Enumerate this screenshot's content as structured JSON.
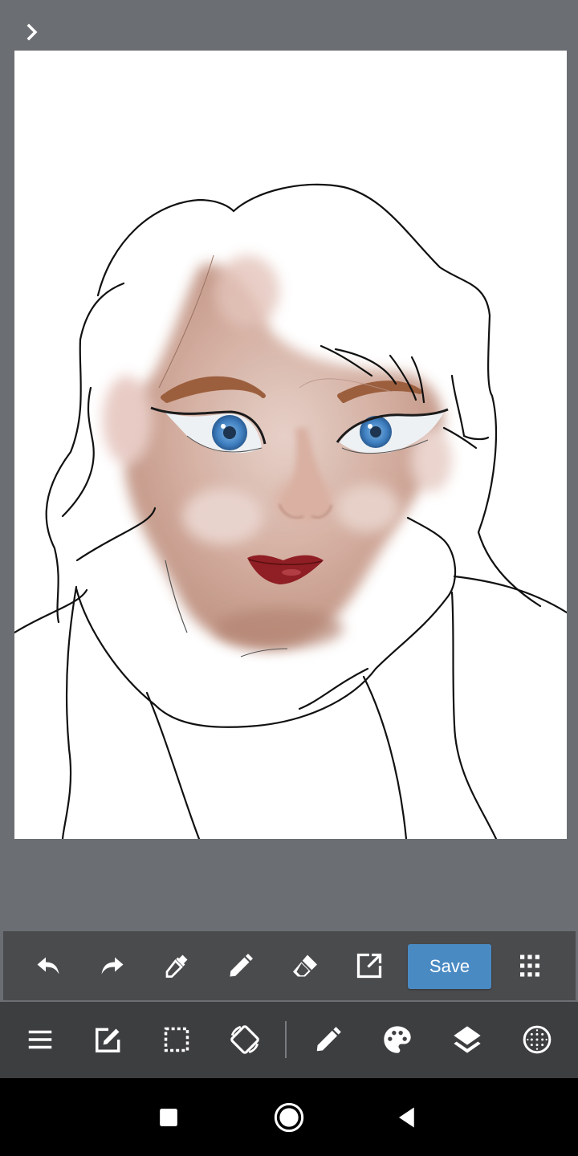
{
  "header": {
    "expand_icon": "chevron-right-icon"
  },
  "toolbar_top": {
    "tools": [
      "undo-icon",
      "redo-icon",
      "eyedropper-icon",
      "pencil-icon",
      "eraser-icon",
      "open-external-icon"
    ],
    "save_label": "Save",
    "more_icon": "grid-dots-icon"
  },
  "toolbar_bottom": {
    "tools": [
      "menu-icon",
      "edit-icon",
      "selection-icon",
      "rotate-screen-icon",
      "brush-icon",
      "palette-icon",
      "layers-icon",
      "grid-icon"
    ]
  },
  "navbar": {
    "buttons": [
      "recent-apps-icon",
      "home-icon",
      "back-icon"
    ]
  },
  "colors": {
    "background": "#6b6e73",
    "canvas": "#ffffff",
    "toolbar_top": "#4a4b4d",
    "toolbar_bottom": "#3d3e40",
    "accent": "#4a8ac3"
  }
}
